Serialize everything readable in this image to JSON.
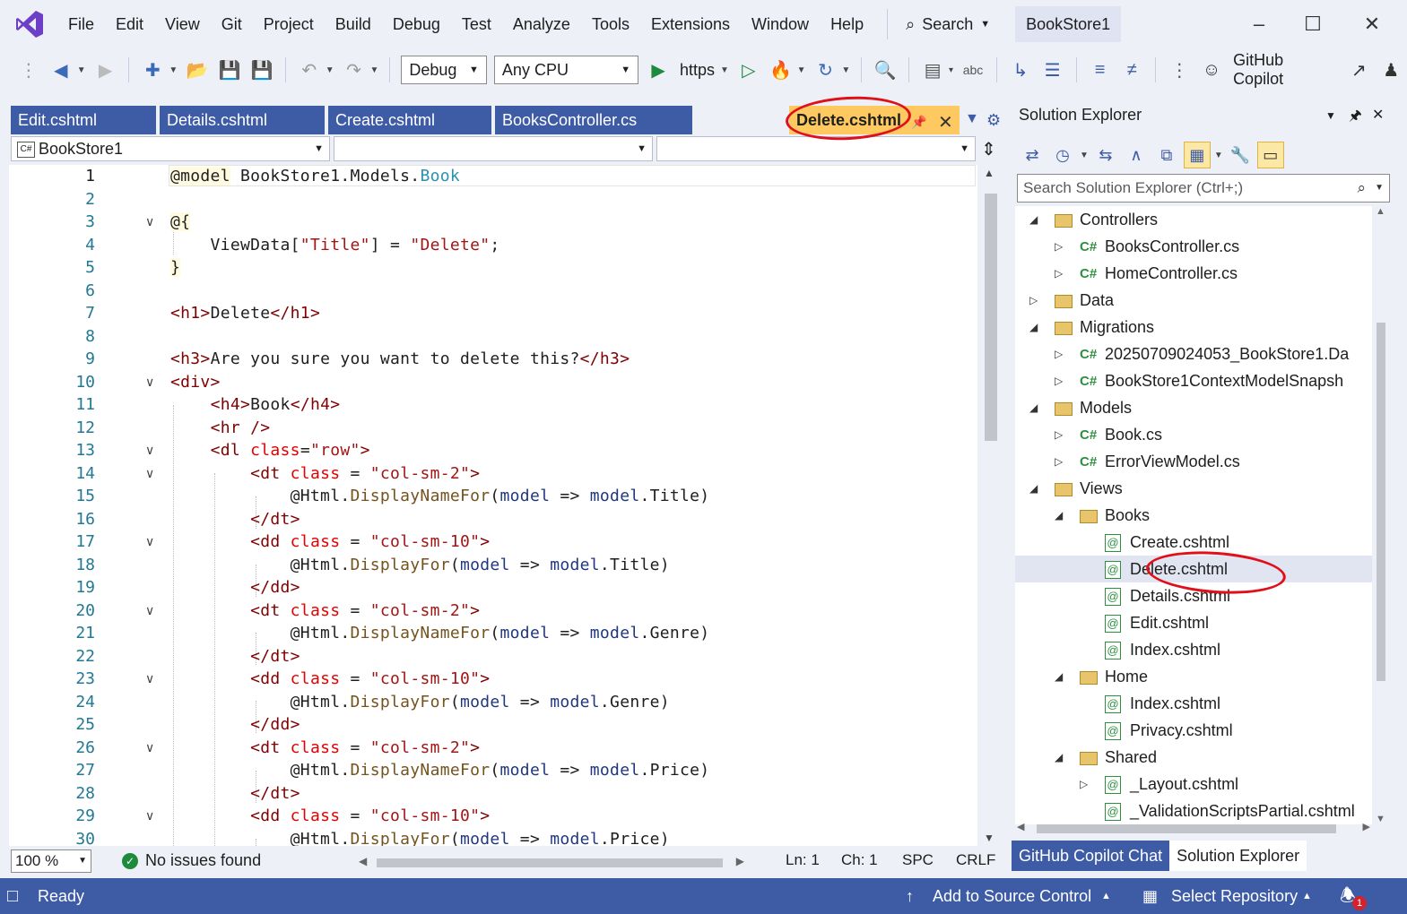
{
  "menubar": {
    "items": [
      "File",
      "Edit",
      "View",
      "Git",
      "Project",
      "Build",
      "Debug",
      "Test",
      "Analyze",
      "Tools",
      "Extensions",
      "Window",
      "Help"
    ],
    "search_label": "Search",
    "solution_name": "BookStore1"
  },
  "toolbar": {
    "config": "Debug",
    "platform": "Any CPU",
    "run_target": "https",
    "copilot_label": "GitHub Copilot"
  },
  "tabs": [
    {
      "label": "Edit.cshtml",
      "active": false
    },
    {
      "label": "Details.cshtml",
      "active": false
    },
    {
      "label": "Create.cshtml",
      "active": false
    },
    {
      "label": "BooksController.cs",
      "active": false
    },
    {
      "label": "Delete.cshtml",
      "active": true
    }
  ],
  "navbar": {
    "project": "BookStore1"
  },
  "code_lines": [
    {
      "n": "1",
      "fold": "",
      "html": "<span class='razor'>@model</span> BookStore1.Models.<span class='type'>Book</span>"
    },
    {
      "n": "2",
      "fold": "",
      "html": ""
    },
    {
      "n": "3",
      "fold": "v",
      "html": "<span class='razor'>@{</span>"
    },
    {
      "n": "4",
      "fold": "",
      "html": "    ViewData[<span class='str'>\"Title\"</span>] = <span class='str'>\"Delete\"</span>;"
    },
    {
      "n": "5",
      "fold": "",
      "html": "<span class='razor'>}</span>"
    },
    {
      "n": "6",
      "fold": "",
      "html": ""
    },
    {
      "n": "7",
      "fold": "",
      "html": "<span class='tag'>&lt;h1&gt;</span>Delete<span class='tag'>&lt;/h1&gt;</span>"
    },
    {
      "n": "8",
      "fold": "",
      "html": ""
    },
    {
      "n": "9",
      "fold": "",
      "html": "<span class='tag'>&lt;h3&gt;</span>Are you sure you want to delete this?<span class='tag'>&lt;/h3&gt;</span>"
    },
    {
      "n": "10",
      "fold": "v",
      "html": "<span class='tag'>&lt;div&gt;</span>"
    },
    {
      "n": "11",
      "fold": "",
      "html": "    <span class='tag'>&lt;h4&gt;</span>Book<span class='tag'>&lt;/h4&gt;</span>"
    },
    {
      "n": "12",
      "fold": "",
      "html": "    <span class='tag'>&lt;hr /&gt;</span>"
    },
    {
      "n": "13",
      "fold": "v",
      "html": "    <span class='tag'>&lt;dl</span> <span class='attr'>class</span>=<span class='str'>\"row\"</span><span class='tag'>&gt;</span>"
    },
    {
      "n": "14",
      "fold": "v",
      "html": "        <span class='tag'>&lt;dt</span> <span class='attr'>class</span> = <span class='str'>\"col-sm-2\"</span><span class='tag'>&gt;</span>"
    },
    {
      "n": "15",
      "fold": "",
      "html": "            @Html.<span class='method'>DisplayNameFor</span>(<span class='param'>model</span> =&gt; <span class='param'>model</span>.Title)"
    },
    {
      "n": "16",
      "fold": "",
      "html": "        <span class='tag'>&lt;/dt&gt;</span>"
    },
    {
      "n": "17",
      "fold": "v",
      "html": "        <span class='tag'>&lt;dd</span> <span class='attr'>class</span> = <span class='str'>\"col-sm-10\"</span><span class='tag'>&gt;</span>"
    },
    {
      "n": "18",
      "fold": "",
      "html": "            @Html.<span class='method'>DisplayFor</span>(<span class='param'>model</span> =&gt; <span class='param'>model</span>.Title)"
    },
    {
      "n": "19",
      "fold": "",
      "html": "        <span class='tag'>&lt;/dd&gt;</span>"
    },
    {
      "n": "20",
      "fold": "v",
      "html": "        <span class='tag'>&lt;dt</span> <span class='attr'>class</span> = <span class='str'>\"col-sm-2\"</span><span class='tag'>&gt;</span>"
    },
    {
      "n": "21",
      "fold": "",
      "html": "            @Html.<span class='method'>DisplayNameFor</span>(<span class='param'>model</span> =&gt; <span class='param'>model</span>.Genre)"
    },
    {
      "n": "22",
      "fold": "",
      "html": "        <span class='tag'>&lt;/dt&gt;</span>"
    },
    {
      "n": "23",
      "fold": "v",
      "html": "        <span class='tag'>&lt;dd</span> <span class='attr'>class</span> = <span class='str'>\"col-sm-10\"</span><span class='tag'>&gt;</span>"
    },
    {
      "n": "24",
      "fold": "",
      "html": "            @Html.<span class='method'>DisplayFor</span>(<span class='param'>model</span> =&gt; <span class='param'>model</span>.Genre)"
    },
    {
      "n": "25",
      "fold": "",
      "html": "        <span class='tag'>&lt;/dd&gt;</span>"
    },
    {
      "n": "26",
      "fold": "v",
      "html": "        <span class='tag'>&lt;dt</span> <span class='attr'>class</span> = <span class='str'>\"col-sm-2\"</span><span class='tag'>&gt;</span>"
    },
    {
      "n": "27",
      "fold": "",
      "html": "            @Html.<span class='method'>DisplayNameFor</span>(<span class='param'>model</span> =&gt; <span class='param'>model</span>.Price)"
    },
    {
      "n": "28",
      "fold": "",
      "html": "        <span class='tag'>&lt;/dt&gt;</span>"
    },
    {
      "n": "29",
      "fold": "v",
      "html": "        <span class='tag'>&lt;dd</span> <span class='attr'>class</span> = <span class='str'>\"col-sm-10\"</span><span class='tag'>&gt;</span>"
    },
    {
      "n": "30",
      "fold": "",
      "html": "            @Html.<span class='method'>DisplayFor</span>(<span class='param'>model</span> =&gt; <span class='param'>model</span>.Price)"
    }
  ],
  "editor_status": {
    "zoom": "100 %",
    "issues": "No issues found",
    "ln": "Ln: 1",
    "ch": "Ch: 1",
    "spc": "SPC",
    "eol": "CRLF"
  },
  "solution_explorer": {
    "title": "Solution Explorer",
    "search_placeholder": "Search Solution Explorer (Ctrl+;)",
    "tree": [
      {
        "label": "Controllers",
        "kind": "folder",
        "depth": 0,
        "twisty": "open"
      },
      {
        "label": "BooksController.cs",
        "kind": "cs",
        "depth": 1,
        "twisty": "closed"
      },
      {
        "label": "HomeController.cs",
        "kind": "cs",
        "depth": 1,
        "twisty": "closed"
      },
      {
        "label": "Data",
        "kind": "folder",
        "depth": 0,
        "twisty": "closed"
      },
      {
        "label": "Migrations",
        "kind": "folder",
        "depth": 0,
        "twisty": "open"
      },
      {
        "label": "20250709024053_BookStore1.Da",
        "kind": "cs",
        "depth": 1,
        "twisty": "closed"
      },
      {
        "label": "BookStore1ContextModelSnapsh",
        "kind": "cs",
        "depth": 1,
        "twisty": "closed"
      },
      {
        "label": "Models",
        "kind": "folder",
        "depth": 0,
        "twisty": "open"
      },
      {
        "label": "Book.cs",
        "kind": "cs",
        "depth": 1,
        "twisty": "closed"
      },
      {
        "label": "ErrorViewModel.cs",
        "kind": "cs",
        "depth": 1,
        "twisty": "closed"
      },
      {
        "label": "Views",
        "kind": "folder",
        "depth": 0,
        "twisty": "open"
      },
      {
        "label": "Books",
        "kind": "folder",
        "depth": 1,
        "twisty": "open"
      },
      {
        "label": "Create.cshtml",
        "kind": "razor",
        "depth": 2,
        "twisty": ""
      },
      {
        "label": "Delete.cshtml",
        "kind": "razor",
        "depth": 2,
        "twisty": "",
        "selected": true
      },
      {
        "label": "Details.cshtml",
        "kind": "razor",
        "depth": 2,
        "twisty": ""
      },
      {
        "label": "Edit.cshtml",
        "kind": "razor",
        "depth": 2,
        "twisty": ""
      },
      {
        "label": "Index.cshtml",
        "kind": "razor",
        "depth": 2,
        "twisty": ""
      },
      {
        "label": "Home",
        "kind": "folder",
        "depth": 1,
        "twisty": "open"
      },
      {
        "label": "Index.cshtml",
        "kind": "razor",
        "depth": 2,
        "twisty": ""
      },
      {
        "label": "Privacy.cshtml",
        "kind": "razor",
        "depth": 2,
        "twisty": ""
      },
      {
        "label": "Shared",
        "kind": "folder",
        "depth": 1,
        "twisty": "open"
      },
      {
        "label": "_Layout.cshtml",
        "kind": "razor",
        "depth": 2,
        "twisty": "closed"
      },
      {
        "label": "_ValidationScriptsPartial.cshtml",
        "kind": "razor",
        "depth": 2,
        "twisty": ""
      }
    ],
    "bottom_tabs": [
      "GitHub Copilot Chat",
      "Solution Explorer"
    ]
  },
  "statusbar": {
    "ready": "Ready",
    "add_source_control": "Add to Source Control",
    "select_repo": "Select Repository",
    "notification_count": "1"
  },
  "colors": {
    "accent": "#3e5ba6",
    "active_tab": "#fdc960",
    "annotation": "#e0101a"
  }
}
